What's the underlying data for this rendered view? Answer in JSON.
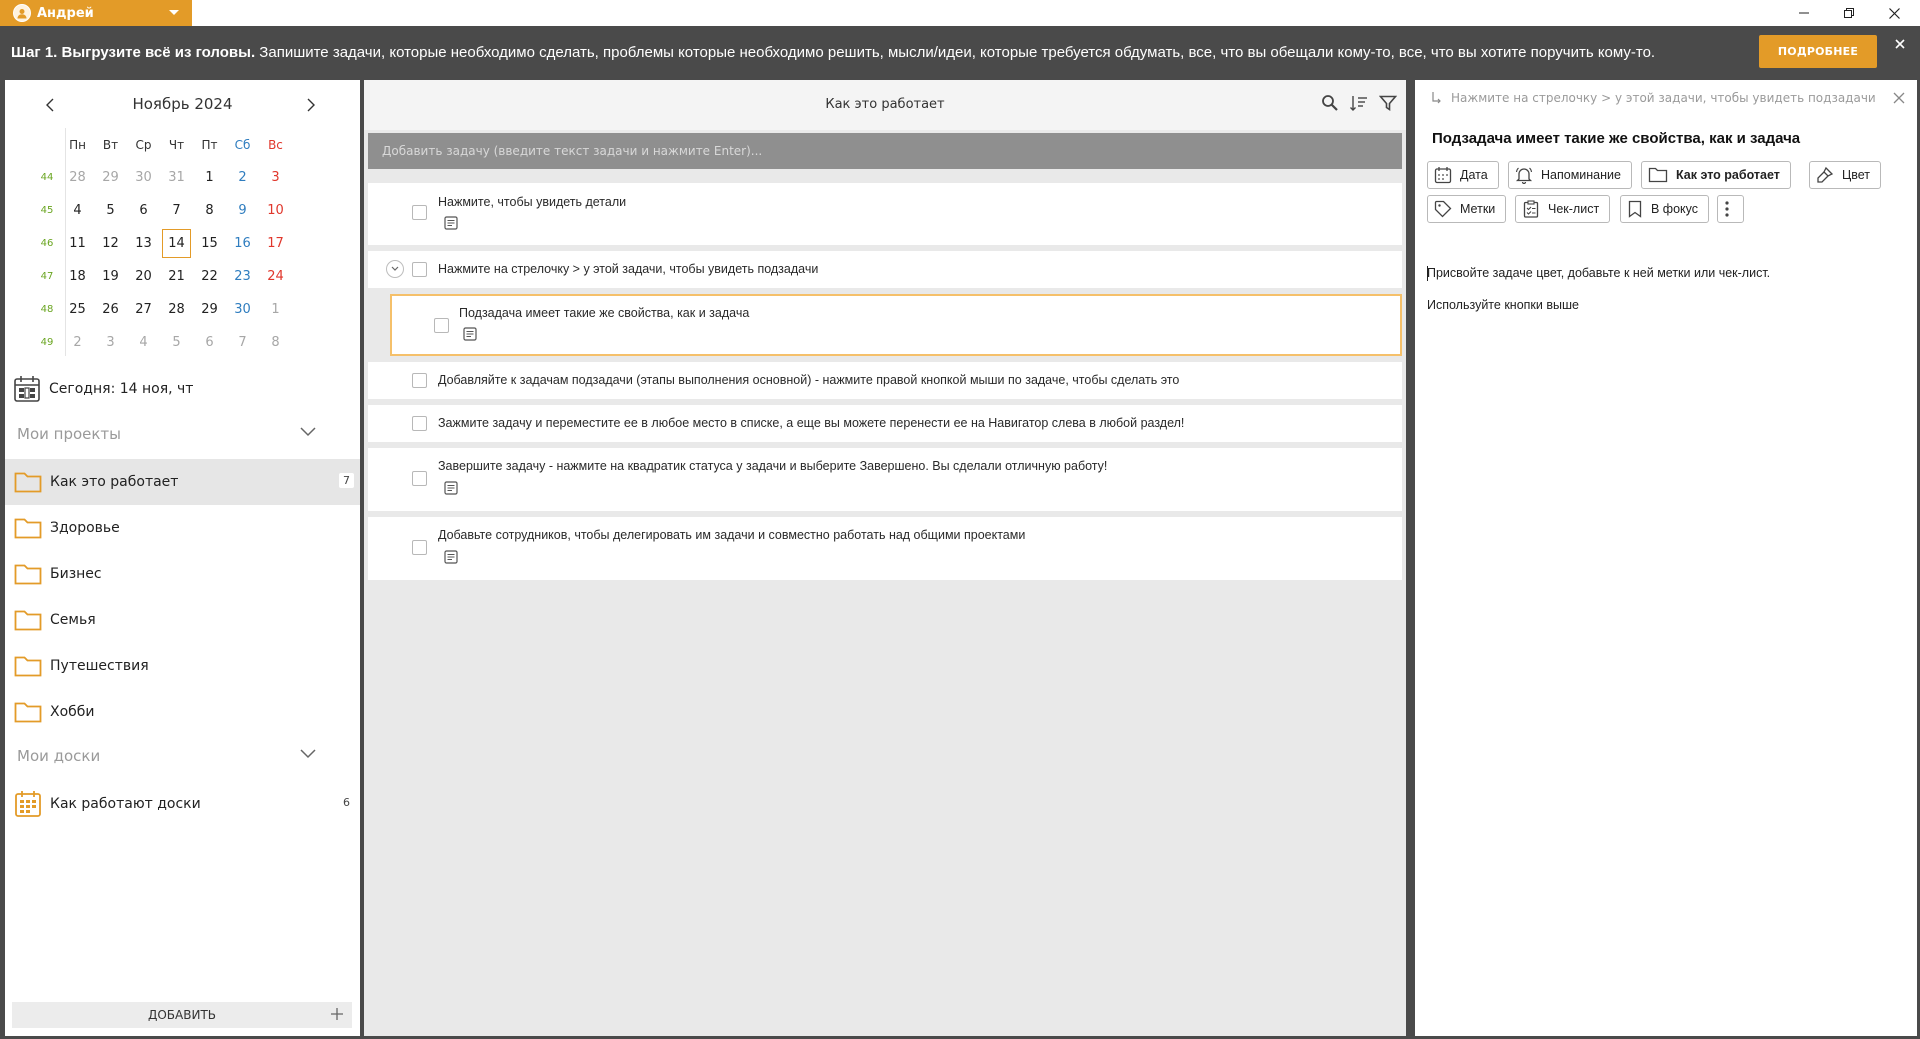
{
  "user": {
    "name": "Андрей"
  },
  "banner": {
    "bold": "Шаг 1. Выгрузите всё из головы.",
    "text": " Запишите задачи, которые необходимо сделать, проблемы которые необходимо решить, мысли/идеи, которые требуется обдумать, все, что вы обещали кому-то, все, что вы хотите поручить кому-то.",
    "button": "ПОДРОБНЕЕ"
  },
  "calendar": {
    "month": "Ноябрь 2024",
    "weekdays": [
      "Пн",
      "Вт",
      "Ср",
      "Чт",
      "Пт",
      "Сб",
      "Вс"
    ],
    "weeks": [
      {
        "n": "44",
        "days": [
          "28",
          "29",
          "30",
          "31",
          "1",
          "2",
          "3"
        ]
      },
      {
        "n": "45",
        "days": [
          "4",
          "5",
          "6",
          "7",
          "8",
          "9",
          "10"
        ]
      },
      {
        "n": "46",
        "days": [
          "11",
          "12",
          "13",
          "14",
          "15",
          "16",
          "17"
        ]
      },
      {
        "n": "47",
        "days": [
          "18",
          "19",
          "20",
          "21",
          "22",
          "23",
          "24"
        ]
      },
      {
        "n": "48",
        "days": [
          "25",
          "26",
          "27",
          "28",
          "29",
          "30",
          "1"
        ]
      },
      {
        "n": "49",
        "days": [
          "2",
          "3",
          "4",
          "5",
          "6",
          "7",
          "8"
        ]
      }
    ],
    "today_label": "Сегодня: 14 ноя, чт",
    "accent": "#e39b28",
    "saturday_color": "#2f7dbf",
    "sunday_color": "#e0372c"
  },
  "projects": {
    "header": "Мои проекты",
    "items": [
      {
        "label": "Как это работает",
        "count": "7"
      },
      {
        "label": "Здоровье"
      },
      {
        "label": "Бизнес"
      },
      {
        "label": "Семья"
      },
      {
        "label": "Путешествия"
      },
      {
        "label": "Хобби"
      }
    ]
  },
  "boards": {
    "header": "Мои доски",
    "items": [
      {
        "label": "Как работают доски",
        "count": "6"
      }
    ]
  },
  "add_button": "ДОБАВИТЬ",
  "task_list": {
    "title": "Как это работает",
    "add_placeholder": "Добавить задачу (введите текст задачи и нажмите Enter)...",
    "tasks": [
      "Нажмите, чтобы увидеть детали",
      "Нажмите на стрелочку > у этой задачи, чтобы увидеть подзадачи",
      "Подзадача имеет такие же свойства, как и задача",
      "Добавляйте к задачам подзадачи (этапы выполнения основной) - нажмите правой кнопкой мыши по задаче, чтобы сделать это",
      "Зажмите задачу и переместите ее в любое место в списке, а еще вы можете перенести ее на Навигатор слева в любой раздел!",
      "Завершите задачу - нажмите на квадратик статуса у задачи и выберите Завершено. Вы сделали отличную работу!",
      "Добавьте сотрудников, чтобы делегировать им задачи и совместно работать над общими проектами"
    ]
  },
  "detail": {
    "breadcrumb": "Нажмите на стрелочку > у этой задачи, чтобы увидеть подзадачи",
    "title": "Подзадача имеет такие же свойства, как и задача",
    "chips": {
      "date": "Дата",
      "reminder": "Напоминание",
      "project": "Как это работает",
      "color": "Цвет",
      "tags": "Метки",
      "checklist": "Чек-лист",
      "focus": "В фокус"
    },
    "desc1": "Присвойте задаче цвет, добавьте к ней метки или чек-лист.",
    "desc2": "Используйте кнопки выше"
  }
}
